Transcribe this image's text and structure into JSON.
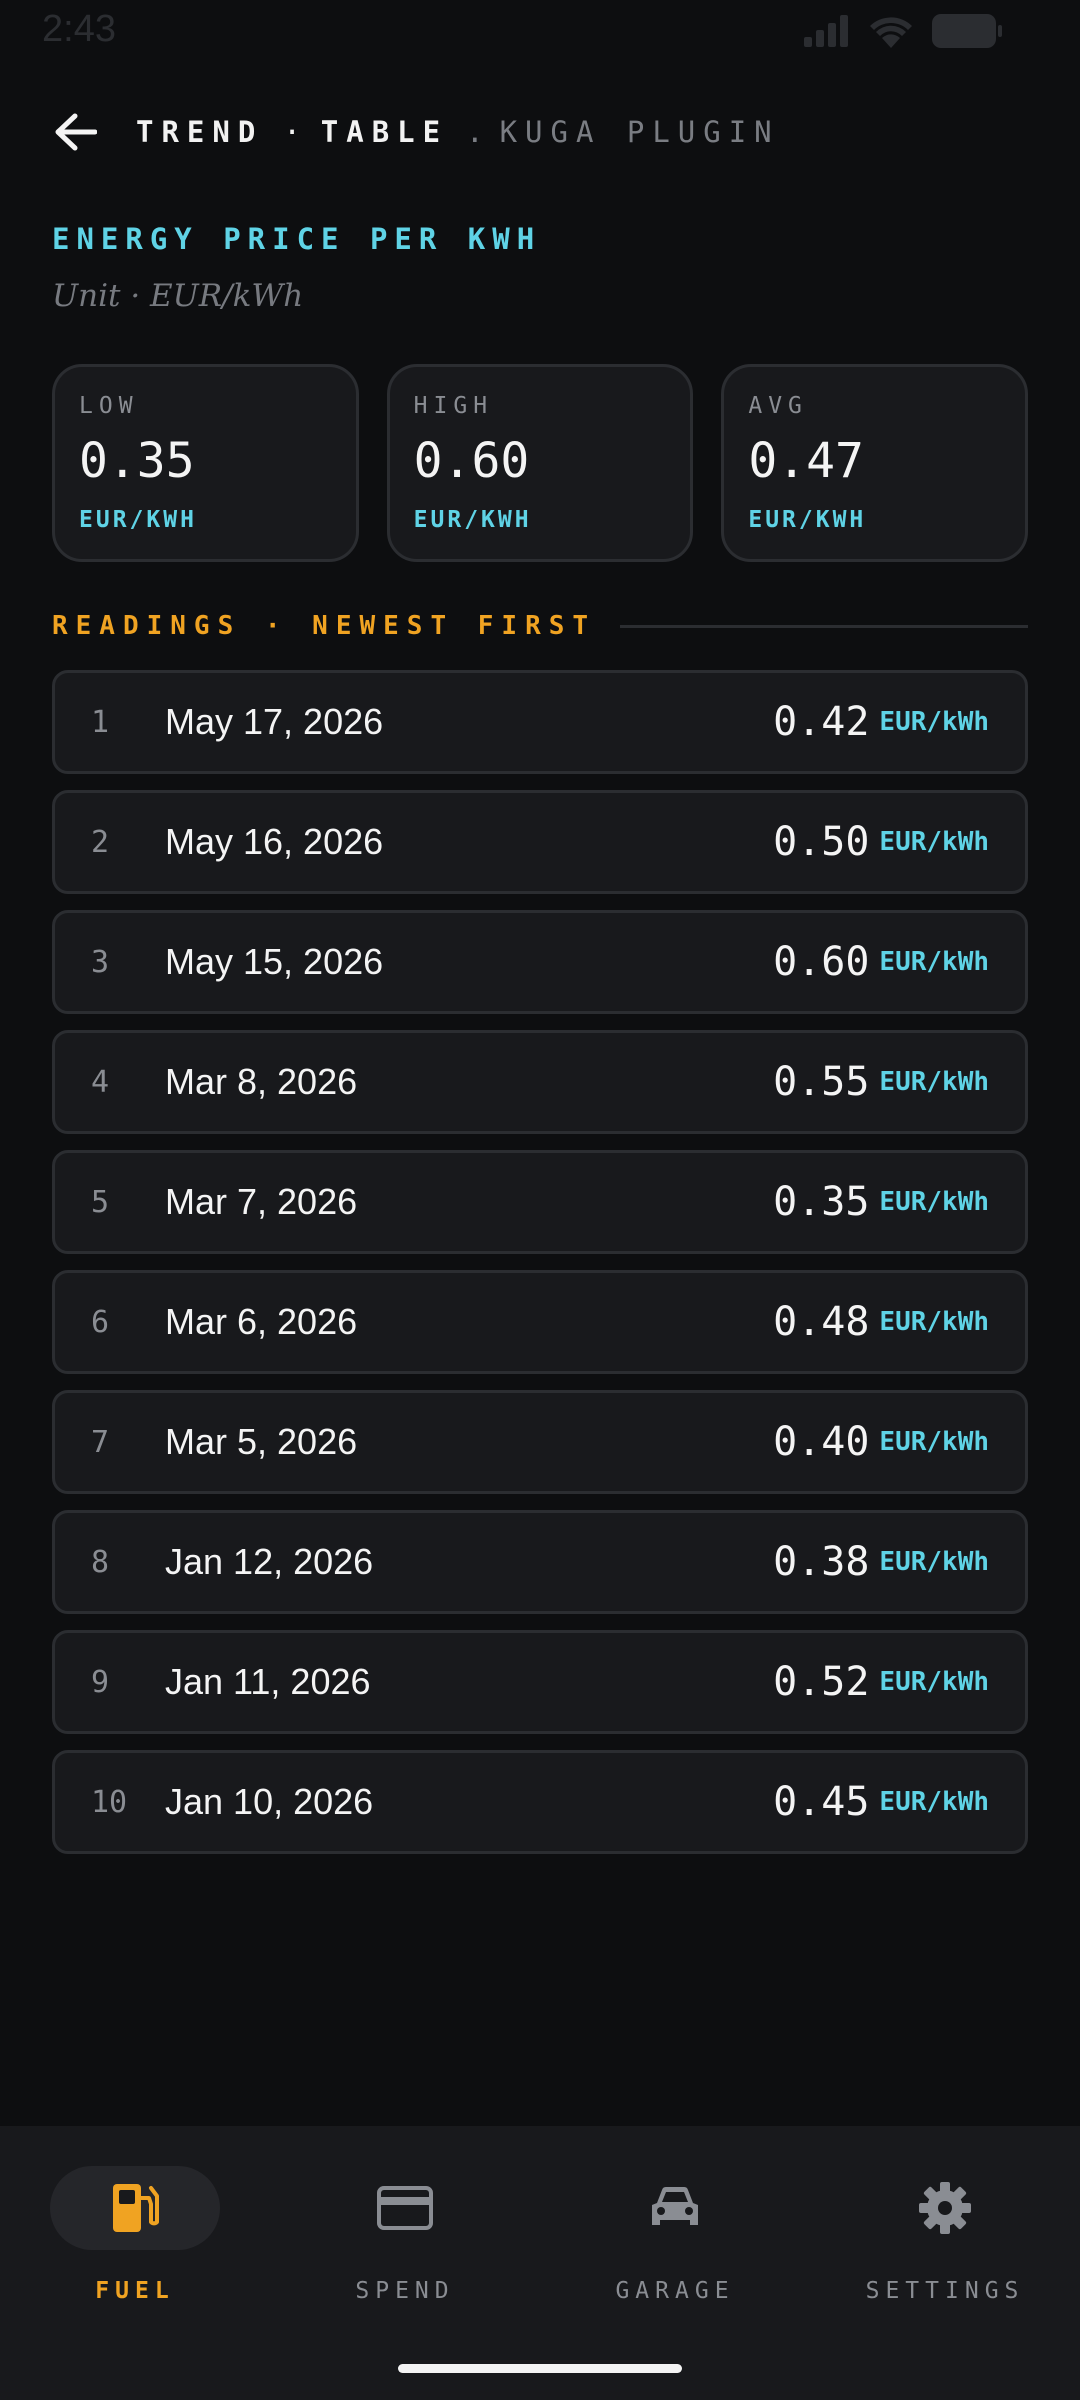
{
  "status_bar": {
    "time": "2:43"
  },
  "header": {
    "crumb_1": "TREND",
    "crumb_sep": "·",
    "crumb_2": "TABLE",
    "crumb_dot": ".",
    "crumb_3": "KUGA PLUGIN"
  },
  "section": {
    "title": "ENERGY PRICE PER KWH",
    "unit_line": "Unit · EUR/kWh"
  },
  "stats": [
    {
      "label": "LOW",
      "value": "0.35",
      "unit": "EUR/KWH"
    },
    {
      "label": "HIGH",
      "value": "0.60",
      "unit": "EUR/KWH"
    },
    {
      "label": "AVG",
      "value": "0.47",
      "unit": "EUR/KWH"
    }
  ],
  "readings": {
    "title": "READINGS · NEWEST FIRST",
    "unit": "EUR/kWh",
    "rows": [
      {
        "index": "1",
        "date": "May 17, 2026",
        "value": "0.42"
      },
      {
        "index": "2",
        "date": "May 16, 2026",
        "value": "0.50"
      },
      {
        "index": "3",
        "date": "May 15, 2026",
        "value": "0.60"
      },
      {
        "index": "4",
        "date": "Mar 8, 2026",
        "value": "0.55"
      },
      {
        "index": "5",
        "date": "Mar 7, 2026",
        "value": "0.35"
      },
      {
        "index": "6",
        "date": "Mar 6, 2026",
        "value": "0.48"
      },
      {
        "index": "7",
        "date": "Mar 5, 2026",
        "value": "0.40"
      },
      {
        "index": "8",
        "date": "Jan 12, 2026",
        "value": "0.38"
      },
      {
        "index": "9",
        "date": "Jan 11, 2026",
        "value": "0.52"
      },
      {
        "index": "10",
        "date": "Jan 10, 2026",
        "value": "0.45"
      }
    ]
  },
  "nav": {
    "items": [
      {
        "label": "FUEL",
        "icon": "fuel-pump-icon",
        "active": true
      },
      {
        "label": "SPEND",
        "icon": "credit-card-icon",
        "active": false
      },
      {
        "label": "GARAGE",
        "icon": "car-icon",
        "active": false
      },
      {
        "label": "SETTINGS",
        "icon": "gear-icon",
        "active": false
      }
    ]
  },
  "colors": {
    "background": "#0d0e10",
    "card": "#18191c",
    "border": "#2b2d31",
    "cyan_accent": "#5fd3e6",
    "orange_accent": "#f0a322",
    "muted": "#8a8d93"
  }
}
